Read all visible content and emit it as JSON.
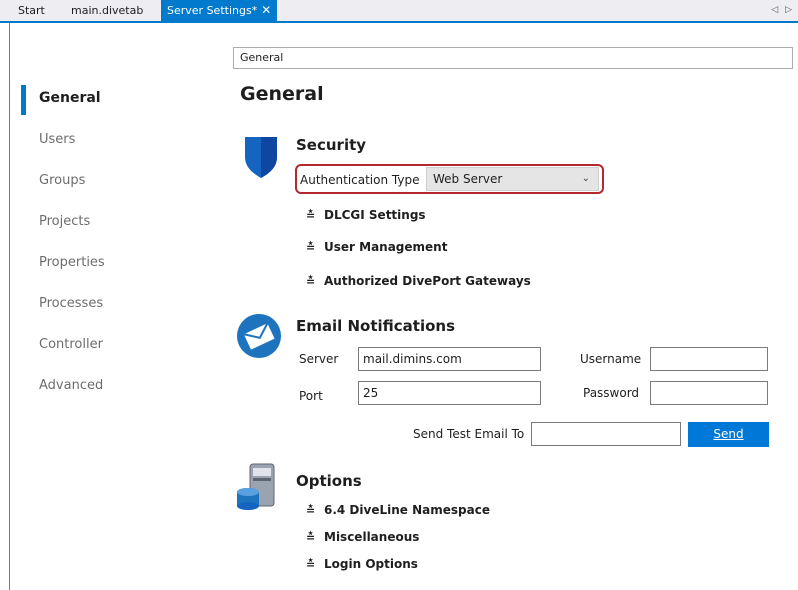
{
  "tabs": [
    {
      "label": "Start"
    },
    {
      "label": "main.divetab"
    },
    {
      "label": "Server Settings*",
      "close": "✕"
    }
  ],
  "tab_scroll": "◁ ▷",
  "sidebar": {
    "items": [
      {
        "label": "General"
      },
      {
        "label": "Users"
      },
      {
        "label": "Groups"
      },
      {
        "label": "Projects"
      },
      {
        "label": "Properties"
      },
      {
        "label": "Processes"
      },
      {
        "label": "Controller"
      },
      {
        "label": "Advanced"
      }
    ],
    "selected": "General"
  },
  "breadcrumb": "General",
  "page_title": "General",
  "security": {
    "title": "Security",
    "auth_label": "Authentication Type",
    "auth_value": "Web Server",
    "sections": [
      "DLCGI Settings",
      "User Management",
      "Authorized DivePort Gateways"
    ]
  },
  "email": {
    "title": "Email Notifications",
    "server_label": "Server",
    "server_value": "mail.dimins.com",
    "port_label": "Port",
    "port_value": "25",
    "username_label": "Username",
    "username_value": "",
    "password_label": "Password",
    "password_value": "",
    "test_label": "Send Test Email To",
    "test_value": "",
    "send_label": "Send"
  },
  "options": {
    "title": "Options",
    "sections": [
      "6.4 DiveLine Namespace",
      "Miscellaneous",
      "Login Options"
    ]
  },
  "colors": {
    "accent": "#007acc",
    "highlight_border": "#b4282e",
    "send_button": "#0078d7"
  },
  "icons": {
    "security": "shield-icon",
    "email": "envelope-icon",
    "options": "server-database-icon",
    "expander": "double-chevron-down-icon"
  }
}
